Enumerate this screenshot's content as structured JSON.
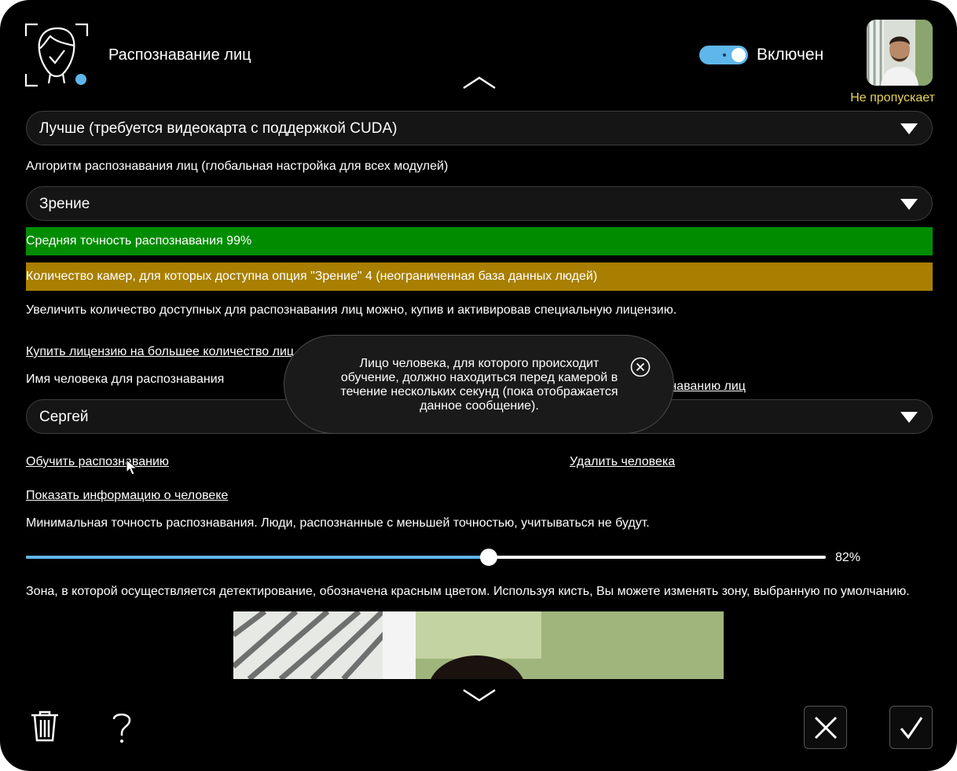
{
  "header": {
    "title": "Распознавание лиц",
    "toggle_label": "Включен",
    "avatar_caption": "Не пропускает",
    "icon": "face-recognition-icon"
  },
  "quality_select": {
    "value": "Лучше (требуется видеокарта с поддержкой CUDA)"
  },
  "algorithm_label": "Алгоритм распознавания лиц (глобальная настройка для всех модулей)",
  "algorithm_select": {
    "value": "Зрение"
  },
  "accuracy_bar": {
    "text": "Средняя точность распознавания 99%",
    "color": "#008c00"
  },
  "cameras_bar": {
    "text": "Количество камер, для которых доступна опция \"Зрение\" 4 (неограниченная база данных людей)",
    "color": "#a87f00"
  },
  "license_note": "Увеличить количество доступных для распознавания лиц можно, купив и активировав специальную лицензию.",
  "buy_license_link": "Купить лицензию на большее количество лиц",
  "person_label": "Имя человека для распознавания",
  "right_link_fragment": "знаванию лиц",
  "person_select": {
    "value": "Сергей"
  },
  "train_link": "Обучить распознаванию",
  "delete_link": "Удалить человека",
  "show_info_link": "Показать информацию о человеке",
  "min_accuracy_label": "Минимальная точность распознавания. Люди, распознанные с меньшей точностью, учитываться не будут.",
  "slider": {
    "value": 82,
    "value_text": "82%"
  },
  "zone_label": "Зона, в которой осуществляется детектирование, обозначена красным цветом. Используя кисть, Вы можете изменять зону, выбранную по умолчанию.",
  "tooltip": {
    "text": "Лицо человека, для которого происходит\nобучение, должно находиться перед камерой в\nтечение нескольких секунд (пока отображается\nданное сообщение)."
  },
  "toolbar": {
    "delete_icon": "trash-icon",
    "help_icon": "question-icon",
    "cancel_icon": "close-icon",
    "confirm_icon": "check-icon"
  },
  "colors": {
    "accent": "#5fb6ea",
    "warning_text": "#e8d35a"
  }
}
